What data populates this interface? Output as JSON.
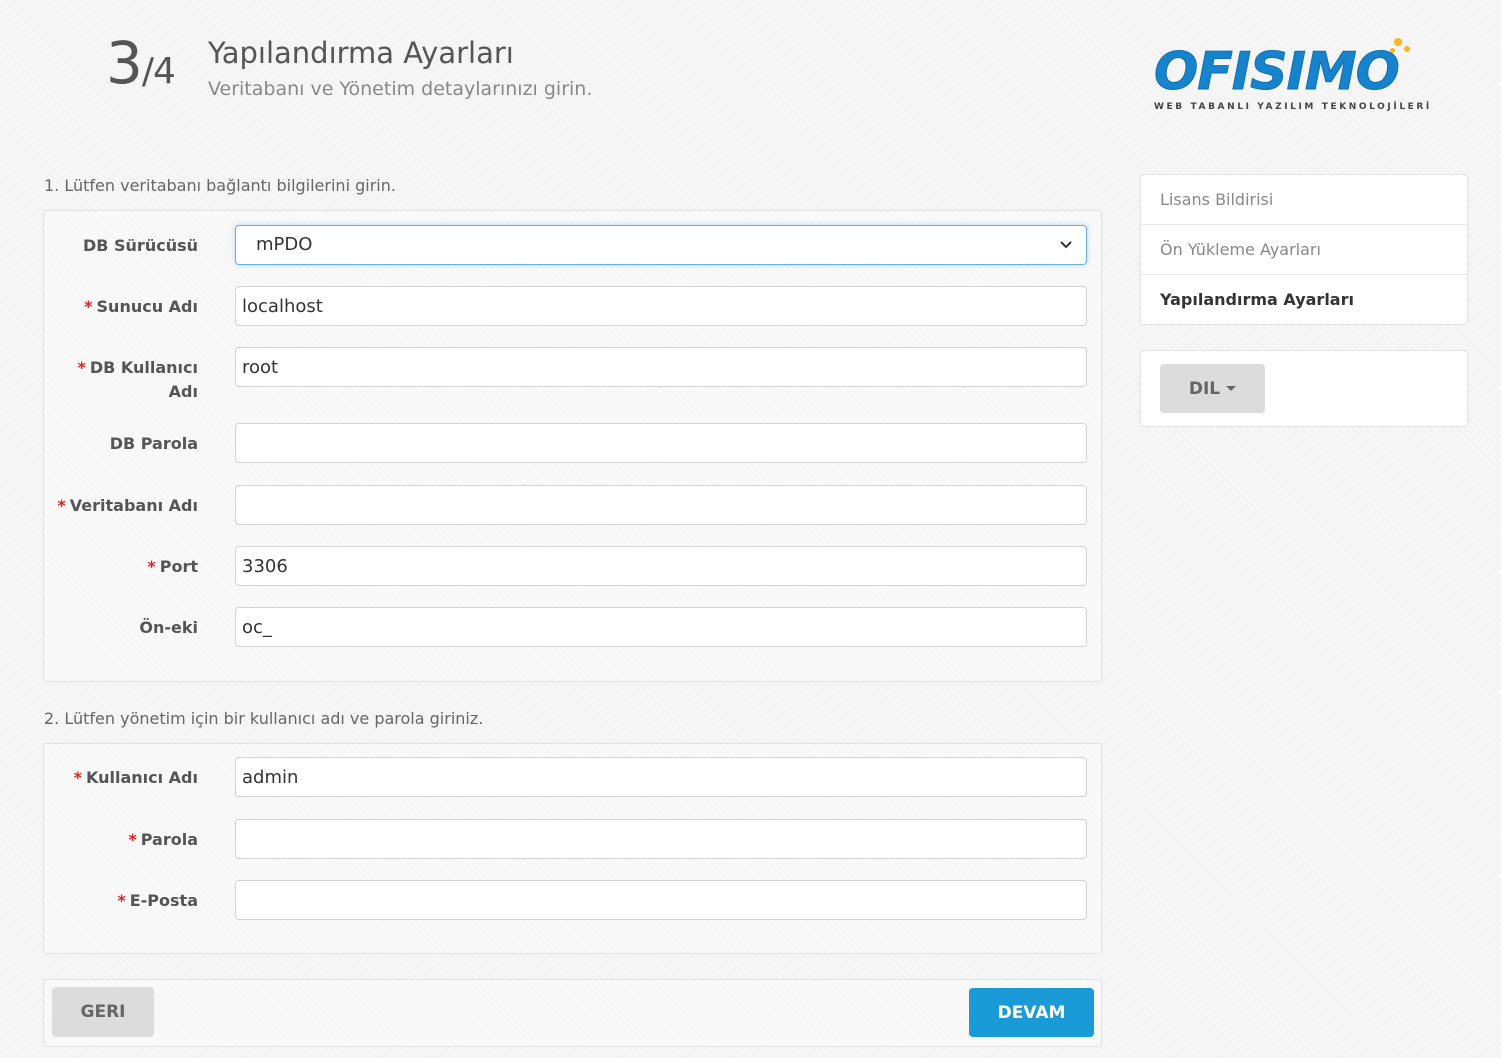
{
  "header": {
    "step_current": "3",
    "step_total": "/4",
    "title": "Yapılandırma Ayarları",
    "subtitle": "Veritabanı ve Yönetim detaylarınızı girin."
  },
  "logo": {
    "name": "OFISIMO",
    "tagline": "WEB TABANLI YAZILIM TEKNOLOJİLERİ",
    "colors": {
      "primary": "#1683cc",
      "accent": "#f6b81a"
    }
  },
  "db_section": {
    "heading": "1. Lütfen veritabanı bağlantı bilgilerini girin.",
    "driver": {
      "label": "DB Sürücüsü",
      "value": "mPDO"
    },
    "hostname": {
      "label": "Sunucu Adı",
      "value": "localhost",
      "required": "*"
    },
    "username": {
      "label_line1": "DB Kullanıcı",
      "label_line2": "Adı",
      "value": "root",
      "required": "*"
    },
    "password": {
      "label": "DB Parola",
      "value": ""
    },
    "database": {
      "label": "Veritabanı Adı",
      "value": "",
      "required": "*"
    },
    "port": {
      "label": "Port",
      "value": "3306",
      "required": "*"
    },
    "prefix": {
      "label": "Ön-eki",
      "value": "oc_"
    }
  },
  "admin_section": {
    "heading": "2. Lütfen yönetim için bir kullanıcı adı ve parola giriniz.",
    "username": {
      "label": "Kullanıcı Adı",
      "value": "admin",
      "required": "*"
    },
    "password": {
      "label": "Parola",
      "value": "",
      "required": "*"
    },
    "email": {
      "label": "E-Posta",
      "value": "",
      "required": "*"
    }
  },
  "actions": {
    "back_label": "GERI",
    "continue_label": "DEVAM"
  },
  "sidebar": {
    "items": [
      {
        "label": "Lisans Bildirisi"
      },
      {
        "label": "Ön Yükleme Ayarları"
      },
      {
        "label": "Yapılandırma Ayarları"
      }
    ],
    "language_button": "DIL"
  },
  "colors": {
    "primary_button": "#1a9ad6",
    "required_marker": "#e02020",
    "focus_border": "#66afe9"
  }
}
